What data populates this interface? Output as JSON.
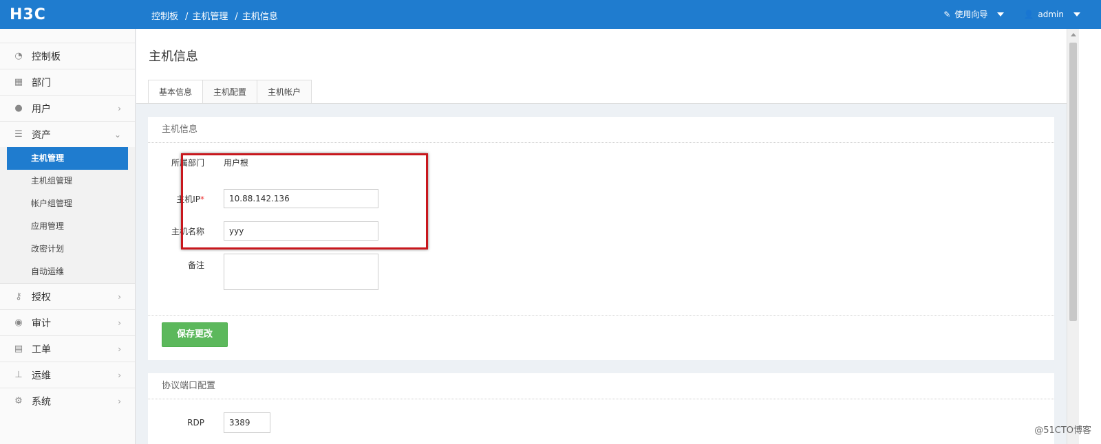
{
  "header": {
    "logo": "H3C",
    "breadcrumb": [
      "控制板",
      "主机管理",
      "主机信息"
    ],
    "guide_label": "使用向导",
    "user_label": "admin"
  },
  "sidebar": {
    "items": [
      {
        "label": "控制板",
        "icon": "dashboard-icon"
      },
      {
        "label": "部门",
        "icon": "grid-icon"
      },
      {
        "label": "用户",
        "icon": "user-icon"
      },
      {
        "label": "资产",
        "icon": "server-icon"
      },
      {
        "label": "授权",
        "icon": "key-icon"
      },
      {
        "label": "审计",
        "icon": "eye-icon"
      },
      {
        "label": "工单",
        "icon": "file-icon"
      },
      {
        "label": "运维",
        "icon": "sitemap-icon"
      },
      {
        "label": "系统",
        "icon": "gear-icon"
      }
    ],
    "sub_items": [
      "主机管理",
      "主机组管理",
      "帐户组管理",
      "应用管理",
      "改密计划",
      "自动运维"
    ]
  },
  "main": {
    "title": "主机信息",
    "tabs": [
      "基本信息",
      "主机配置",
      "主机帐户"
    ],
    "card1": {
      "heading": "主机信息",
      "dept_label": "所属部门",
      "dept_value": "用户根",
      "ip_label": "主机IP",
      "ip_required": "*",
      "ip_value": "10.88.142.136",
      "name_label": "主机名称",
      "name_value": "yyy",
      "remark_label": "备注",
      "save_label": "保存更改"
    },
    "card2": {
      "heading": "协议端口配置",
      "rdp_label": "RDP",
      "rdp_value": "3389"
    }
  },
  "watermark": "@51CTO博客",
  "colors": {
    "primary": "#1f7ccf",
    "success": "#5cb85c",
    "highlight": "#c8171d"
  }
}
